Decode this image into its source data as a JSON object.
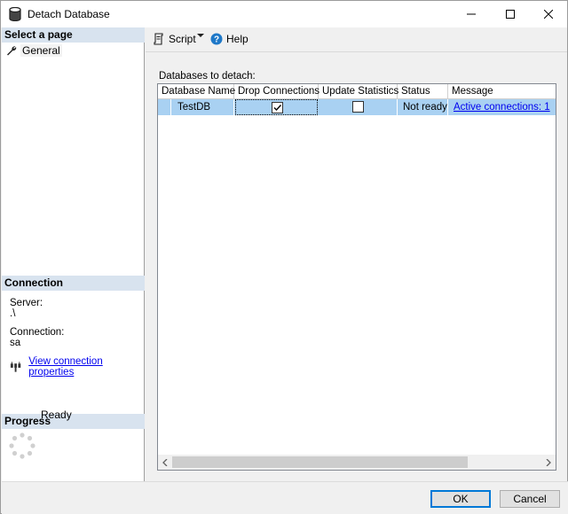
{
  "window": {
    "title": "Detach Database",
    "title_icon": "database-icon"
  },
  "left_pane": {
    "select_page_header": "Select a page",
    "pages": [
      {
        "label": "General",
        "icon": "wrench-icon"
      }
    ],
    "connection_header": "Connection",
    "server_label": "Server:",
    "server_value": ".\\",
    "connection_label": "Connection:",
    "connection_value": "sa",
    "view_connection_link": "View connection properties",
    "progress_header": "Progress",
    "progress_status": "Ready"
  },
  "toolbar": {
    "script_label": "Script",
    "help_label": "Help"
  },
  "main": {
    "grid_caption": "Databases to detach:",
    "columns": [
      "Database Name",
      "Drop Connections",
      "Update Statistics",
      "Status",
      "Message"
    ],
    "rows": [
      {
        "database_name": "TestDB",
        "drop_connections": true,
        "update_statistics": false,
        "status": "Not ready",
        "message": "Active connections: 1"
      }
    ]
  },
  "buttons": {
    "ok": "OK",
    "cancel": "Cancel"
  },
  "colors": {
    "accent": "#0078d7",
    "selection": "#a9d1f2",
    "header_bg": "#d8e3ef",
    "link": "#0000ee"
  }
}
